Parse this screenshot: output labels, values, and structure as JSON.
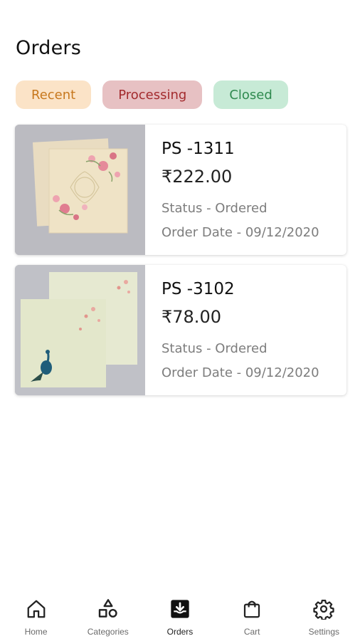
{
  "header": {
    "title": "Orders"
  },
  "filters": [
    {
      "label": "Recent"
    },
    {
      "label": "Processing"
    },
    {
      "label": "Closed"
    }
  ],
  "orders": [
    {
      "id": "PS -1311",
      "price": "₹222.00",
      "status": "Status - Ordered",
      "date": "Order Date - 09/12/2020",
      "image": "floral-invitation-card"
    },
    {
      "id": "PS -3102",
      "price": "₹78.00",
      "status": "Status - Ordered",
      "date": "Order Date - 09/12/2020",
      "image": "peacock-invitation-card"
    }
  ],
  "nav": [
    {
      "label": "Home",
      "icon": "home-icon"
    },
    {
      "label": "Categories",
      "icon": "categories-icon"
    },
    {
      "label": "Orders",
      "icon": "orders-icon",
      "active": true
    },
    {
      "label": "Cart",
      "icon": "cart-icon"
    },
    {
      "label": "Settings",
      "icon": "settings-icon"
    }
  ],
  "colors": {
    "recent_bg": "#fbe3c7",
    "recent_text": "#c7781e",
    "processing_bg": "#e7c1c3",
    "processing_text": "#a32b2e",
    "closed_bg": "#c7ead6",
    "closed_text": "#2f8a4f"
  }
}
